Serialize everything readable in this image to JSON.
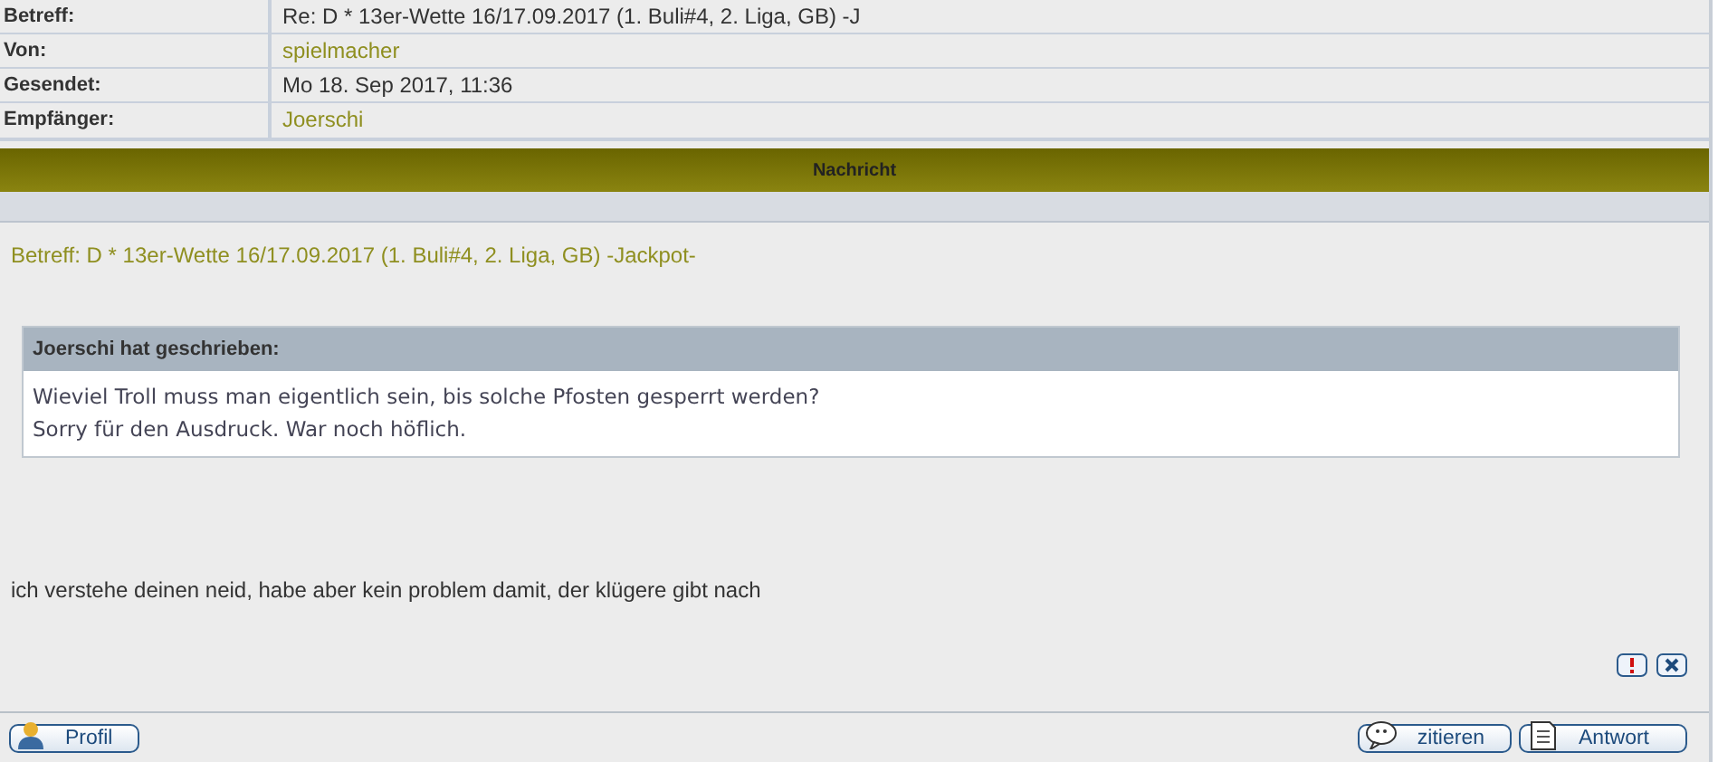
{
  "header_rows": [
    {
      "label": "Betreff:",
      "value": "Re: D * 13er-Wette 16/17.09.2017 (1. Buli#4, 2. Liga, GB) -J",
      "kind": "text"
    },
    {
      "label": "Von:",
      "value": "spielmacher",
      "kind": "link"
    },
    {
      "label": "Gesendet:",
      "value": "Mo 18. Sep 2017, 11:36",
      "kind": "text"
    },
    {
      "label": "Empfänger:",
      "value": "Joerschi",
      "kind": "link"
    }
  ],
  "section_title": "Nachricht",
  "subject": "Betreff: D * 13er-Wette 16/17.09.2017 (1. Buli#4, 2. Liga, GB) -Jackpot-",
  "quote": {
    "author": "Joerschi hat geschrieben:",
    "lines": [
      "Wieviel Troll muss man eigentlich sein, bis solche Pfosten gesperrt werden?",
      "Sorry für den Ausdruck. War noch höflich."
    ]
  },
  "body": "ich verstehe deinen neid, habe aber kein problem damit, der klügere gibt nach",
  "footer_buttons_left": [
    {
      "label": "Profil",
      "kind": "profile"
    }
  ],
  "footer_buttons_right": [
    {
      "label": "zitieren",
      "kind": "quote"
    },
    {
      "label": "Antwort",
      "kind": "reply"
    }
  ]
}
